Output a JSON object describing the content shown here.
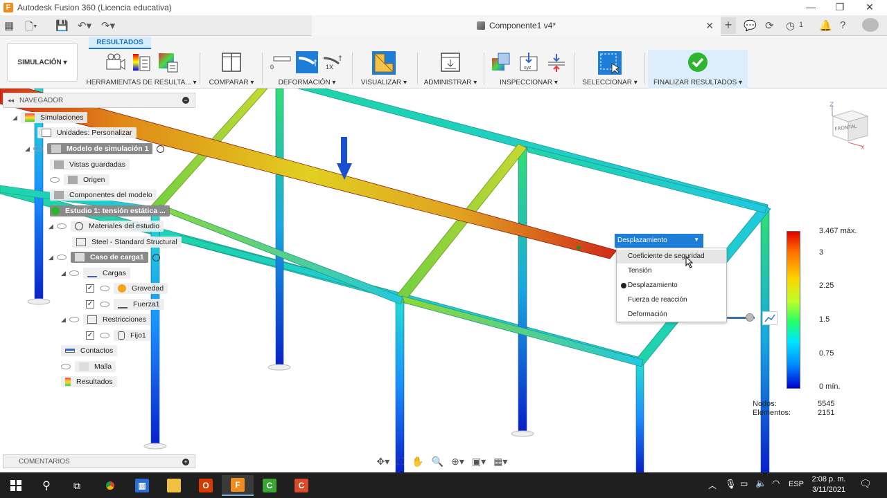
{
  "window": {
    "title": "Autodesk Fusion 360 (Licencia educativa)",
    "controls": {
      "minimize": "—",
      "restore": "❐",
      "close": "✕"
    }
  },
  "tabbar": {
    "document": "Componente1 v4*",
    "plus": "+",
    "notifications_count": "1"
  },
  "ribbon": {
    "workspace": "SIMULACIÓN ▾",
    "active_tab": "RESULTADOS",
    "groups": {
      "herramientas": "HERRAMIENTAS DE RESULTA... ▾",
      "comparar": "COMPARAR ▾",
      "deformacion": "DEFORMACIÓN ▾",
      "deform_scale_0": "0",
      "deform_scale_1x": "1X",
      "visualizar": "VISUALIZAR ▾",
      "administrar": "ADMINISTRAR ▾",
      "inspeccionar": "INSPECCIONAR ▾",
      "seleccionar": "SELECCIONAR ▾",
      "finalizar": "FINALIZAR RESULTADOS ▾"
    }
  },
  "navigator": {
    "title": "NAVEGADOR",
    "rows": {
      "simulaciones": "Simulaciones",
      "unidades": "Unidades: Personalizar",
      "modelo": "Modelo de simulación 1",
      "vistas": "Vistas guardadas",
      "origen": "Origen",
      "componentes": "Componentes del modelo",
      "estudio": "Estudio 1: tensión estática ...",
      "materiales": "Materiales del estudio",
      "steel": "Steel - Standard Structural",
      "caso": "Caso de carga1",
      "cargas": "Cargas",
      "gravedad": "Gravedad",
      "fuerza": "Fuerza1",
      "restricciones": "Restricciones",
      "fijo": "Fijo1",
      "contactos": "Contactos",
      "malla": "Malla",
      "resultados": "Resultados"
    }
  },
  "comments": {
    "title": "COMENTARIOS"
  },
  "result_type": {
    "selected": "Desplazamiento",
    "options": [
      "Coeficiente de seguridad",
      "Tensión",
      "Desplazamiento",
      "Fuerza de reacción",
      "Deformación"
    ],
    "hovered": "Coeficiente de seguridad"
  },
  "legend": {
    "max_label": "3.467  máx.",
    "ticks": [
      "3",
      "2.25",
      "1.5",
      "0.75"
    ],
    "min_label": "0  mín."
  },
  "mesh_stats": {
    "nodes_label": "Nodos:",
    "nodes_value": "5545",
    "elements_label": "Elementos:",
    "elements_value": "2151"
  },
  "viewcube": {
    "face": "FRONTAL",
    "axis_z": "Z",
    "axis_x": "X"
  },
  "taskbar": {
    "language": "ESP",
    "time": "2:08 p. m.",
    "date": "3/11/2021"
  },
  "colors": {
    "accent": "#1e7dd6",
    "finalize_green": "#2db52d",
    "taskbar": "#1f1f1f"
  }
}
